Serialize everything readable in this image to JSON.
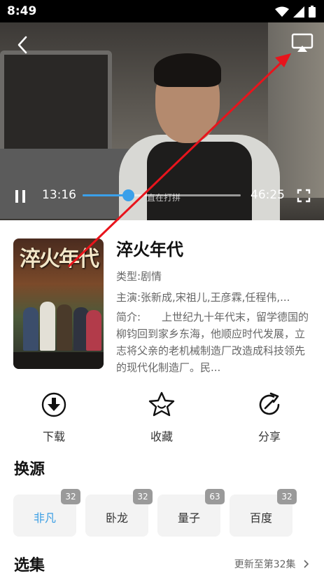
{
  "status_bar": {
    "time": "8:49",
    "icons": [
      "wifi-icon",
      "signal-icon",
      "battery-icon"
    ]
  },
  "player": {
    "current_time": "13:16",
    "total_time": "46:25",
    "progress": 0.286,
    "scrub_hint": "直在打拼",
    "icons": [
      "back-icon",
      "cast-icon",
      "pause-icon",
      "fullscreen-icon"
    ],
    "accent_color": "#3aa0ea"
  },
  "show": {
    "title": "淬火年代",
    "poster_title": "淬火年代",
    "genre": "类型:剧情",
    "cast": "主演:张新成,宋祖儿,王彦霖,任程伟,...",
    "synopsis": "简介:　　上世纪九十年代末，留学德国的柳钧回到家乡东海，他顺应时代发展，立志将父亲的老机械制造厂改造成科技领先的现代化制造厂。民..."
  },
  "actions": [
    {
      "label": "下载",
      "icon": "download-icon"
    },
    {
      "label": "收藏",
      "icon": "star-icon"
    },
    {
      "label": "分享",
      "icon": "share-icon"
    }
  ],
  "sources": {
    "title": "换源",
    "items": [
      {
        "name": "非凡",
        "count": "32",
        "active": true
      },
      {
        "name": "卧龙",
        "count": "32",
        "active": false
      },
      {
        "name": "量子",
        "count": "63",
        "active": false
      },
      {
        "name": "百度",
        "count": "32",
        "active": false
      }
    ]
  },
  "episodes": {
    "title": "选集",
    "update_text": "更新至第32集",
    "update_icon": "chevron-right-icon"
  },
  "annotation_color": "#e8141c"
}
